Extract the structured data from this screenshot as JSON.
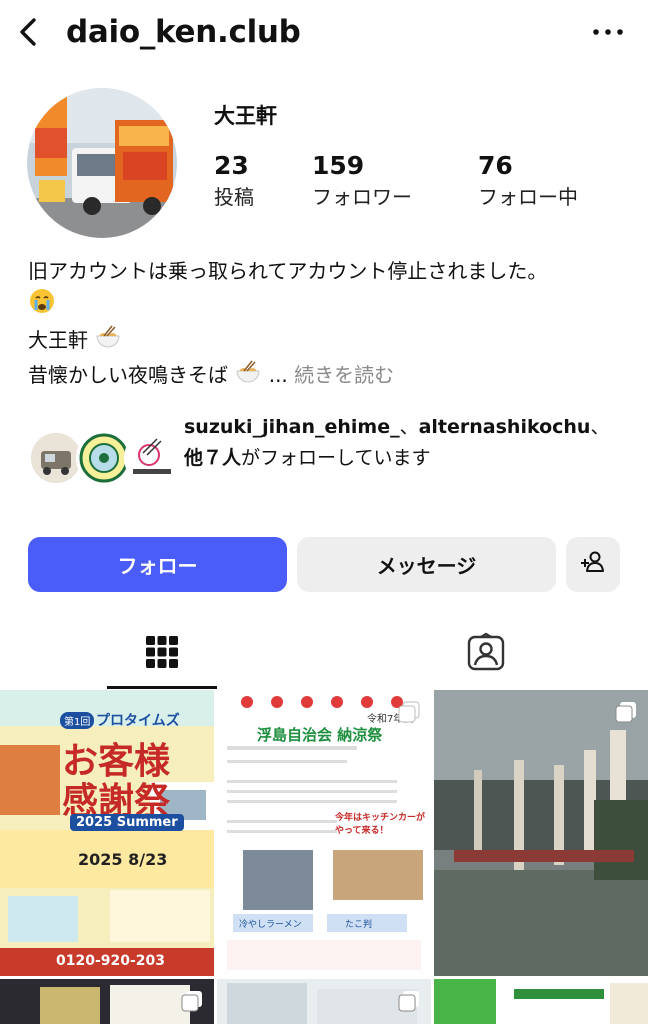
{
  "header": {
    "username": "daio_ken.club",
    "back_icon": "chevron-left-icon",
    "more_icon": "more-horizontal-icon"
  },
  "profile": {
    "display_name": "大王軒",
    "stats": {
      "posts": {
        "value": "23",
        "label": "投稿"
      },
      "followers": {
        "value": "159",
        "label": "フォロワー"
      },
      "following": {
        "value": "76",
        "label": "フォロー中"
      }
    },
    "bio": {
      "line1": "旧アカウントは乗っ取られてアカウント停止されました。",
      "line2_emoji": "crying-face",
      "line3": "大王軒",
      "line4": "昔懐かしい夜鳴きそば",
      "ellipsis": "... ",
      "more_link": "続きを読む"
    }
  },
  "mutual_followers": {
    "account1": "suzuki_jihan_ehime_",
    "sep1": "、",
    "account2": "alternashikochu",
    "sep2": "、",
    "others": "他７人",
    "suffix": "がフォローしています"
  },
  "actions": {
    "follow_label": "フォロー",
    "message_label": "メッセージ",
    "follow_color": "#4a5df9"
  },
  "tabs": {
    "grid_icon": "grid-icon",
    "tagged_icon": "tagged-person-icon"
  },
  "posts": [
    {
      "badge": "第1回",
      "brand": "プロタイムズ",
      "title_line1": "お客様",
      "title_line2": "感謝祭",
      "subtitle": "2025 Summer",
      "date": "2025 8/23",
      "phone": "0120-920-203"
    },
    {
      "era": "令和7年度",
      "title": "浮島自治会 納涼祭",
      "note": "今年はキッチンカーがやって来る！",
      "item1": "冷やしラーメン",
      "item2": "たこ判"
    },
    {
      "caption": ""
    }
  ]
}
